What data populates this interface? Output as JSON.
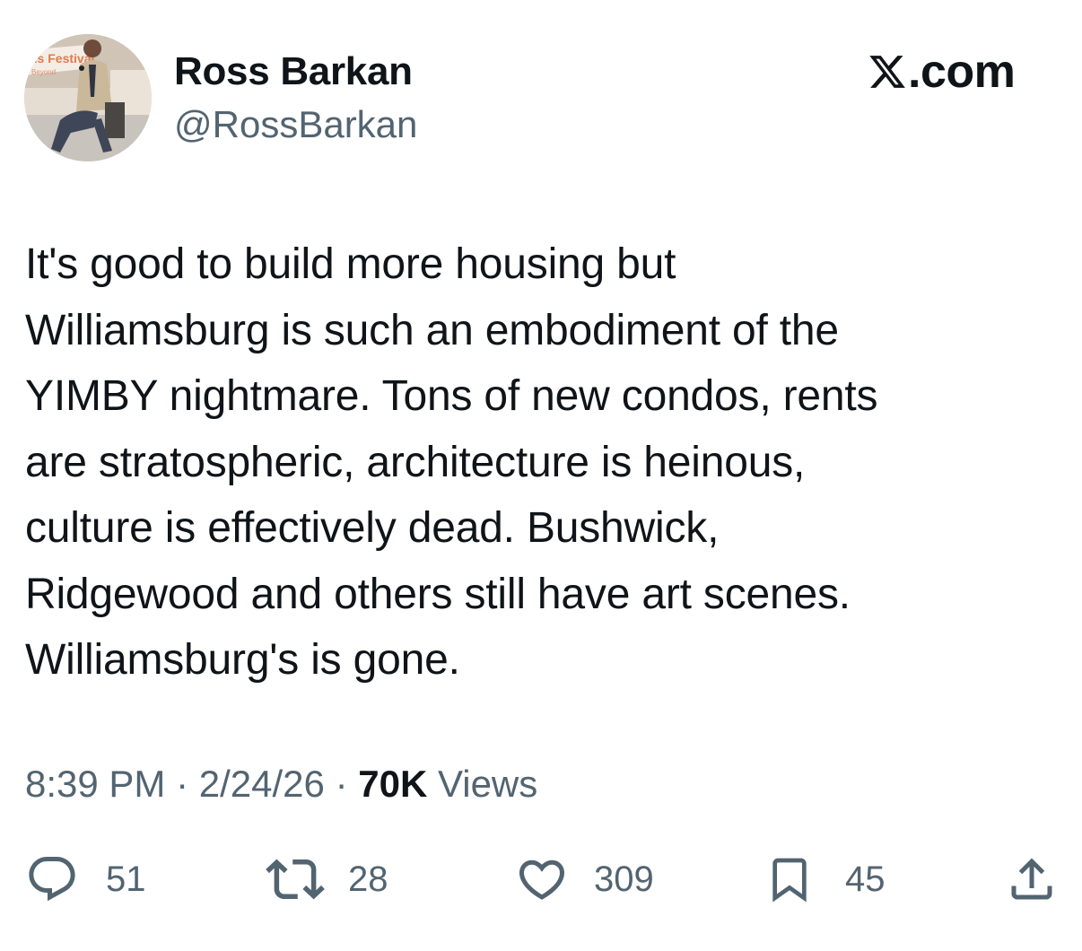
{
  "author": {
    "display_name": "Ross Barkan",
    "handle": "@RossBarkan",
    "avatar_icon": "speaker-photo-avatar",
    "avatar_banner_text": "us Festival",
    "avatar_sub_text": "Beyond"
  },
  "brand": {
    "logo_icon": "x-logo-icon",
    "text": ".com"
  },
  "tweet": {
    "text": "It's good to build more housing but\nWilliamsburg is such an embodiment of the\nYIMBY nightmare. Tons of new condos, rents\nare stratospheric, architecture is heinous,\nculture is effectively dead. Bushwick,\nRidgewood and others still have art scenes.\nWilliamsburg's is gone."
  },
  "meta": {
    "time": "8:39 PM",
    "separator": "·",
    "date": "2/24/26",
    "views_count": "70K",
    "views_label": "Views"
  },
  "actions": {
    "replies": "51",
    "reposts": "28",
    "likes": "309",
    "bookmarks": "45"
  },
  "colors": {
    "text_primary": "#0f1419",
    "text_secondary": "#536471",
    "background": "#ffffff"
  }
}
